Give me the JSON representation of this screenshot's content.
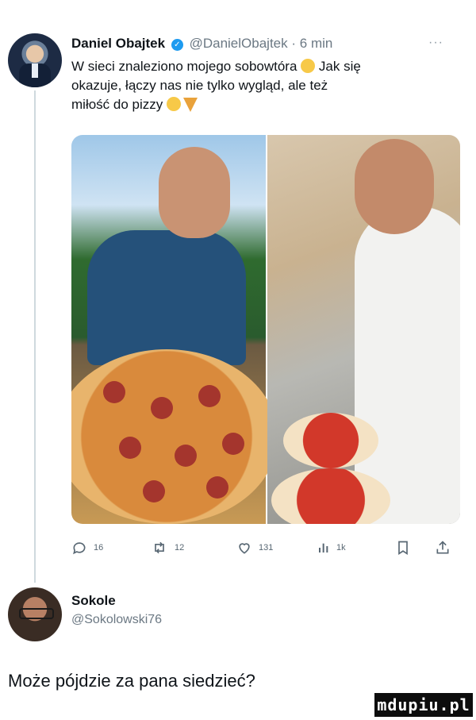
{
  "tweet": {
    "author_name": "Daniel Obajtek",
    "author_handle": "@DanielObajtek",
    "separator": "·",
    "time": "6 min",
    "more": "···",
    "text_line1": "W sieci znaleziono mojego sobowtóra",
    "text_line1b": "Jak się",
    "text_line2": "okazuje, łączy nas nie tylko wygląd, ale też",
    "text_line3": "miłość do pizzy",
    "verified_color": "#1d9bf0"
  },
  "actions": {
    "replies": "16",
    "retweets": "12",
    "likes": "131",
    "views": "1k"
  },
  "reply": {
    "author_name": "Sokole",
    "author_handle": "@Sokolowski76",
    "text": "Może pójdzie za pana siedzieć?"
  },
  "watermark": "mdupiu.pl",
  "icons": [
    "verified-badge-icon",
    "reply-icon",
    "retweet-icon",
    "like-icon",
    "views-icon",
    "bookmark-icon",
    "share-icon",
    "flushed-emoji-icon",
    "wink-emoji-icon",
    "pizza-emoji-icon"
  ]
}
